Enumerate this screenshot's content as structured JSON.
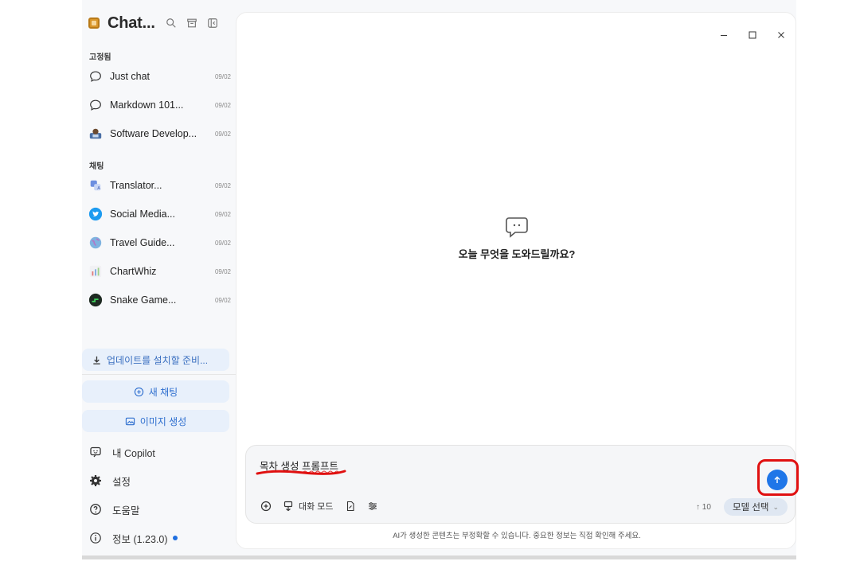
{
  "app": {
    "title": "Chat..."
  },
  "header_icons": [
    "search-icon",
    "archive-icon",
    "collapse-sidebar-icon"
  ],
  "sidebar": {
    "pinned_label": "고정됨",
    "pinned": [
      {
        "label": "Just chat",
        "date": "09/02",
        "icon": "chat-bubble-icon"
      },
      {
        "label": "Markdown 101...",
        "date": "09/02",
        "icon": "chat-bubble-icon"
      },
      {
        "label": "Software Develop...",
        "date": "09/02",
        "icon": "developer-avatar-icon"
      }
    ],
    "chats_label": "채팅",
    "chats": [
      {
        "label": "Translator...",
        "date": "09/02",
        "icon": "translator-avatar-icon"
      },
      {
        "label": "Social Media...",
        "date": "09/02",
        "icon": "twitter-bird-icon"
      },
      {
        "label": "Travel Guide...",
        "date": "09/02",
        "icon": "globe-avatar-icon"
      },
      {
        "label": "ChartWhiz",
        "date": "09/02",
        "icon": "chart-avatar-icon"
      },
      {
        "label": "Snake Game...",
        "date": "09/02",
        "icon": "snake-game-avatar-icon"
      }
    ],
    "update_label": "업데이트를 설치할 준비...",
    "new_chat_label": "새 채팅",
    "image_gen_label": "이미지 생성",
    "menu": {
      "copilot": "내 Copilot",
      "settings": "설정",
      "help": "도움말",
      "about": "정보 (1.23.0)"
    }
  },
  "main": {
    "empty_title": "오늘 무엇을 도와드릴까요?",
    "composer": {
      "value": "목차 생성 프롬프트",
      "mode_label": "대화 모드",
      "token_count": "↑ 10",
      "model_label": "모델 선택"
    },
    "disclaimer": "AI가 생성한 콘텐츠는 부정확할 수 있습니다. 중요한 정보는 직접 확인해 주세요."
  },
  "colors": {
    "accent": "#1f76e8",
    "pill_bg": "#e8f0fb",
    "annotation": "#e01010"
  }
}
